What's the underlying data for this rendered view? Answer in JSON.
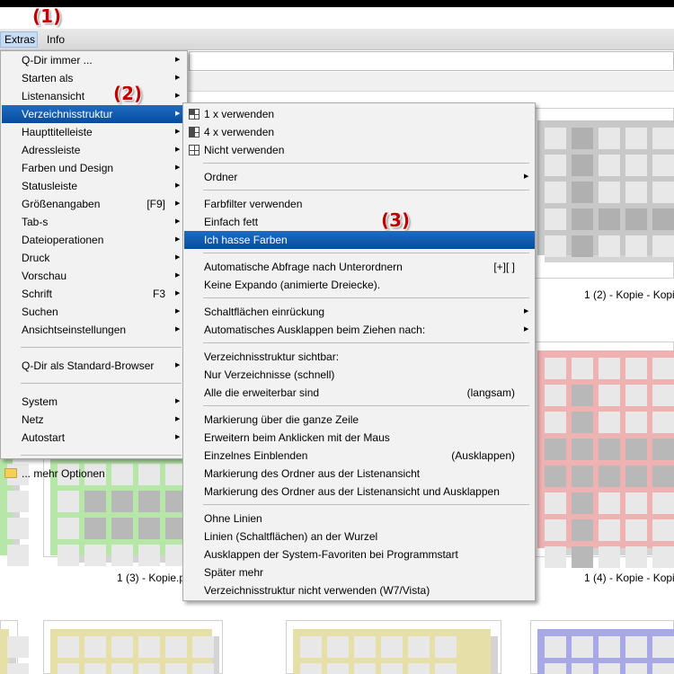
{
  "annotations": [
    "(1)",
    "(2)",
    "(3)"
  ],
  "menubar": {
    "extras": "Extras",
    "info": "Info"
  },
  "extras_menu": [
    {
      "label": "Q-Dir immer ...",
      "arrow": true
    },
    {
      "label": "Starten als",
      "arrow": true
    },
    {
      "label": "Listenansicht",
      "arrow": true
    },
    {
      "label": "Verzeichnisstruktur",
      "arrow": true,
      "highlighted": true
    },
    {
      "label": "Haupttitelleiste",
      "arrow": true
    },
    {
      "label": "Adressleiste",
      "arrow": true
    },
    {
      "label": "Farben und Design",
      "arrow": true
    },
    {
      "label": "Statusleiste",
      "arrow": true
    },
    {
      "label": "Größenangaben",
      "shortcut": "[F9]",
      "arrow": true
    },
    {
      "label": "Tab-s",
      "arrow": true
    },
    {
      "label": "Dateioperationen",
      "arrow": true
    },
    {
      "label": "Druck",
      "arrow": true
    },
    {
      "label": "Vorschau",
      "arrow": true
    },
    {
      "label": "Schrift",
      "shortcut": "F3",
      "arrow": true
    },
    {
      "label": "Suchen",
      "arrow": true
    },
    {
      "label": "Ansichtseinstellungen",
      "arrow": true
    },
    {
      "separator": true
    },
    {
      "label": "Q-Dir als Standard-Browser",
      "arrow": true
    },
    {
      "separator": true
    },
    {
      "label": "System",
      "arrow": true
    },
    {
      "label": "Netz",
      "arrow": true
    },
    {
      "label": "Autostart",
      "arrow": true
    },
    {
      "separator": true
    },
    {
      "label": "... mehr Optionen",
      "icon": "folder-icon"
    }
  ],
  "submenu": [
    {
      "label": "1 x verwenden",
      "icon": "tree-1-icon"
    },
    {
      "label": "4 x verwenden",
      "icon": "tree-4-icon"
    },
    {
      "label": "Nicht verwenden",
      "icon": "tree-off-icon"
    },
    {
      "separator": true
    },
    {
      "label": "Ordner",
      "arrow": true
    },
    {
      "separator": true
    },
    {
      "label": "Farbfilter verwenden"
    },
    {
      "label": "Einfach fett"
    },
    {
      "label": "Ich hasse Farben",
      "highlighted": true
    },
    {
      "separator": true
    },
    {
      "label": "Automatische Abfrage nach Unterordnern",
      "shortcut": "[+][ ]"
    },
    {
      "label": "Keine Expando (animierte Dreiecke)."
    },
    {
      "separator": true
    },
    {
      "label": "Schaltflächen einrückung",
      "arrow": true
    },
    {
      "label": "Automatisches Ausklappen beim Ziehen nach:",
      "arrow": true
    },
    {
      "separator": true
    },
    {
      "label": "Verzeichnisstruktur sichtbar:"
    },
    {
      "label": "Nur Verzeichnisse (schnell)"
    },
    {
      "label": "Alle die erweiterbar sind",
      "shortcut": "(langsam)"
    },
    {
      "separator": true
    },
    {
      "label": "Markierung über die ganze Zeile"
    },
    {
      "label": "Erweitern beim Anklicken mit der Maus"
    },
    {
      "label": "Einzelnes Einblenden",
      "shortcut": "(Ausklappen)"
    },
    {
      "label": "Markierung des Ordner aus der Listenansicht"
    },
    {
      "label": "Markierung des Ordner aus der Listenansicht und Ausklappen"
    },
    {
      "separator": true
    },
    {
      "label": "Ohne Linien"
    },
    {
      "label": "Linien (Schaltflächen) an der Wurzel"
    },
    {
      "label": "Ausklappen der System-Favoriten bei Programmstart"
    },
    {
      "label": "Später mehr"
    },
    {
      "label": "Verzeichnisstruktur nicht verwenden (W7/Vista)"
    }
  ],
  "thumbnails": [
    {
      "label": "1 (2) - Kopie - Kopi",
      "color": "#e2e2e2"
    },
    {
      "label": "1 (3) - Kopie.p"
    },
    {
      "label": "1 (4) - Kopie - Kopi"
    }
  ],
  "colors": {
    "menu_highlight": "#0b57b0",
    "thumb_gray": "#c6c6c6",
    "thumb_red": "#eeb2b2",
    "thumb_green": "#b6e6a8",
    "thumb_yellow": "#e6e0a8",
    "thumb_blue": "#a8a8e6"
  }
}
